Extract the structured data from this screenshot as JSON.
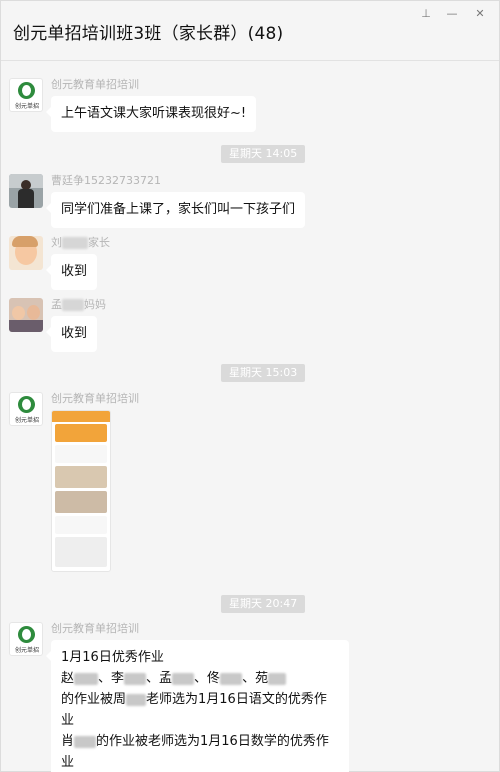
{
  "window": {
    "title": "创元单招培训班3班（家长群）(48)",
    "controls": {
      "pin": "⊥",
      "minimize": "—",
      "close": "✕"
    }
  },
  "messages": [
    {
      "sender": "创元教育单招培训",
      "text": "上午语文课大家听课表现很好~!",
      "avatar": "logo"
    },
    {
      "time": "星期天 14:05"
    },
    {
      "sender": "曹廷争15232733721",
      "text": "同学们准备上课了，家长们叫一下孩子们",
      "avatar": "photo-man"
    },
    {
      "sender_prefix": "刘",
      "sender_suffix": "家长",
      "text": "收到",
      "avatar": "photo-child"
    },
    {
      "sender_prefix": "孟",
      "sender_suffix": "妈妈",
      "text": "收到",
      "avatar": "photo-couple"
    },
    {
      "time": "星期天 15:03"
    },
    {
      "sender": "创元教育单招培训",
      "image": "phone-screenshot",
      "avatar": "logo"
    },
    {
      "time": "星期天 20:47"
    },
    {
      "sender": "创元教育单招培训",
      "avatar": "logo",
      "lines": {
        "l1": "1月16日优秀作业",
        "l2a": "赵",
        "l2b": "、李",
        "l2c": "、孟",
        "l2d": "、佟",
        "l2e": "、苑",
        "l3a": "的作业被周",
        "l3b": "老师选为1月16日语文的优秀作",
        "l4": "业",
        "l5a": "肖",
        "l5b": "的作业被老师选为1月16日数学的优秀作",
        "l6": "业"
      }
    }
  ],
  "logo_text": "创元单招",
  "colors": {
    "accent_green": "#2e8b3d",
    "bubble": "#ffffff",
    "time_badge": "#dadada",
    "background": "#f5f5f5"
  }
}
